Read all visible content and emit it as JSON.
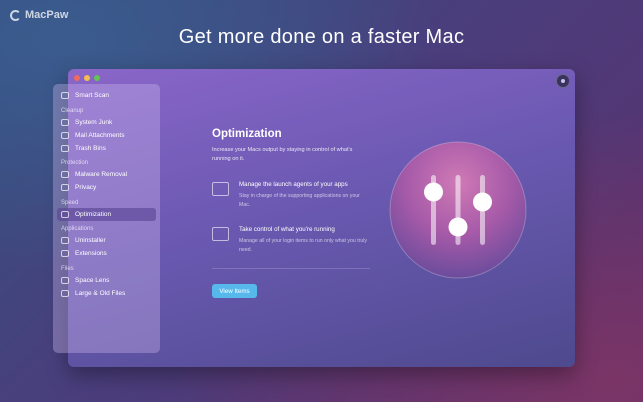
{
  "brand": {
    "name": "MacPaw"
  },
  "headline": "Get more done on a faster Mac",
  "sidebar": {
    "smart_scan": "Smart Scan",
    "sections": {
      "cleanup": "Cleanup",
      "protection": "Protection",
      "speed": "Speed",
      "applications": "Applications",
      "files": "Files"
    },
    "items": {
      "system_junk": "System Junk",
      "mail_attachments": "Mail Attachments",
      "trash_bins": "Trash Bins",
      "malware_removal": "Malware Removal",
      "privacy": "Privacy",
      "optimization": "Optimization",
      "uninstaller": "Uninstaller",
      "extensions": "Extensions",
      "space_lens": "Space Lens",
      "large_old_files": "Large & Old Files"
    },
    "active": "optimization"
  },
  "main": {
    "title": "Optimization",
    "description": "Increase your Macs output by staying in control of what's running on it.",
    "features": [
      {
        "title": "Manage the launch agents of your apps",
        "description": "Stay in charge of the supporting applications on your Mac.",
        "icon": "launch-agents-icon"
      },
      {
        "title": "Take control of what you're running",
        "description": "Manage all of your login items to run only what you truly need.",
        "icon": "activity-chart-icon"
      }
    ],
    "button_label": "View Items"
  },
  "colors": {
    "accent_button": "#57b8ec",
    "illustration_circle": "#c06aa8"
  }
}
